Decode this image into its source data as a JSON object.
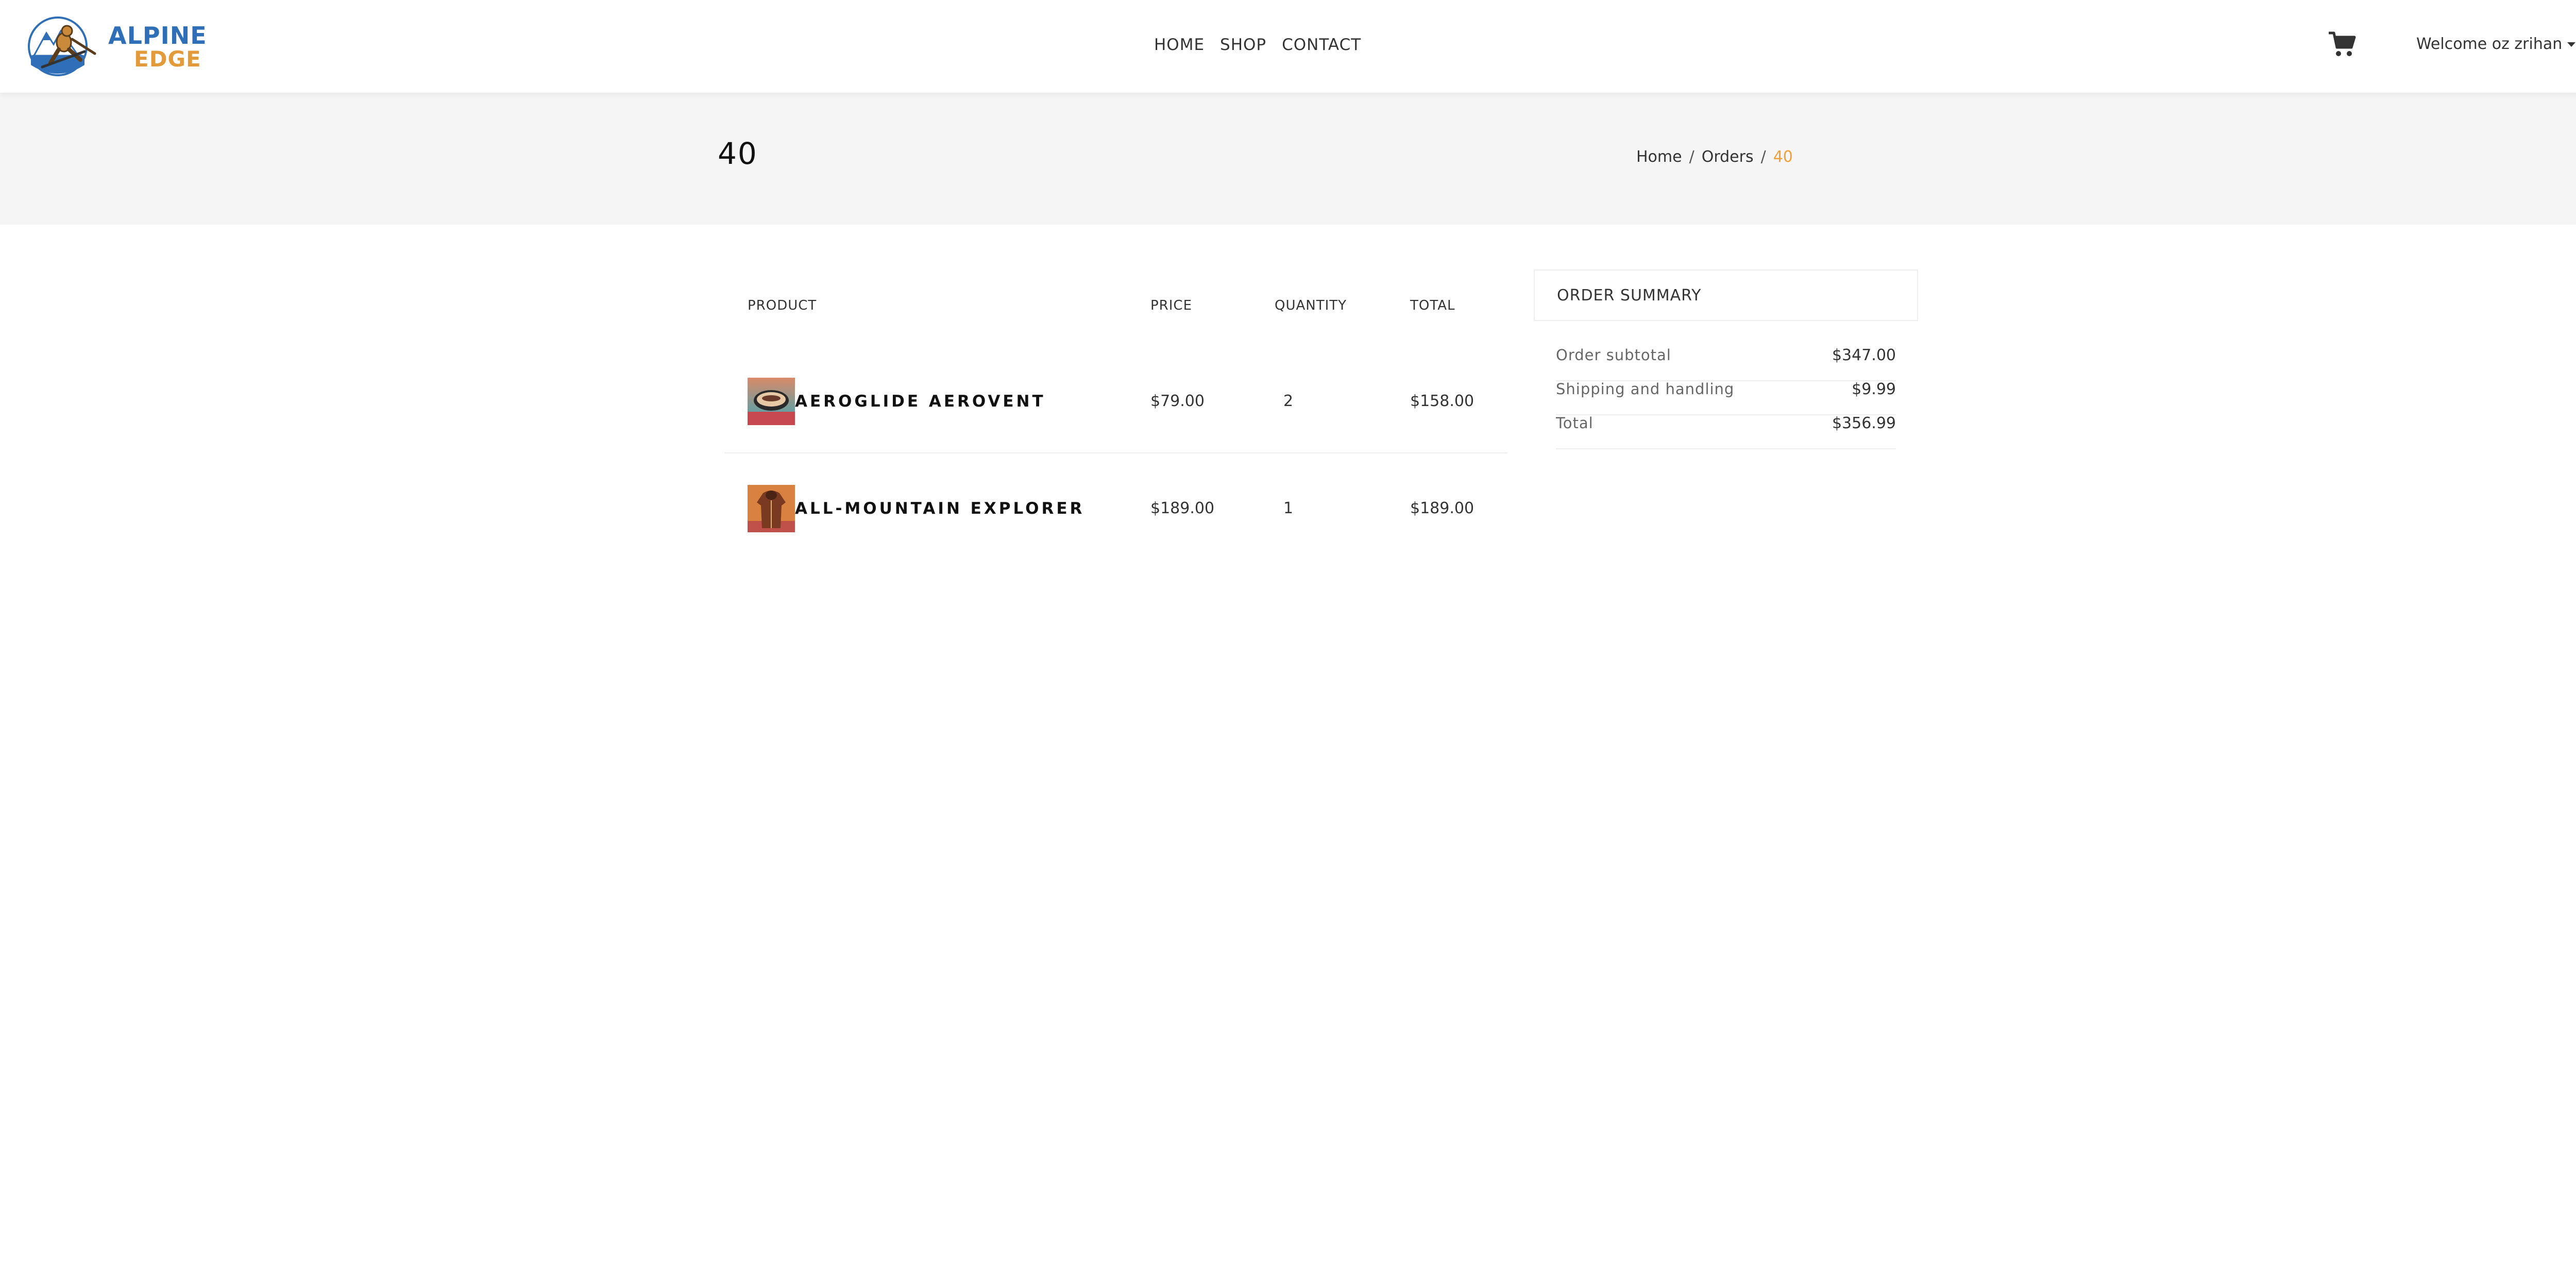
{
  "brand": {
    "name_line1": "ALPINE",
    "name_line2": "EDGE",
    "logo_icon": "skier-mountain-logo",
    "colors": {
      "blue": "#2f6fb7",
      "orange": "#e39a3a"
    }
  },
  "nav": {
    "links": [
      "HOME",
      "SHOP",
      "CONTACT"
    ],
    "cart_icon": "shopping-cart-icon",
    "user_greeting": "Welcome oz zrihan"
  },
  "page_header": {
    "title": "40",
    "breadcrumb": {
      "home": "Home",
      "orders": "Orders",
      "current": "40",
      "separator": "/"
    },
    "accent_color": "#f0a036"
  },
  "order_table": {
    "headers": {
      "product": "PRODUCT",
      "price": "PRICE",
      "quantity": "QUANTITY",
      "total": "TOTAL"
    },
    "items": [
      {
        "name": "AEROGLIDE AEROVENT",
        "price": "$79.00",
        "quantity": "2",
        "total": "$158.00",
        "image": "ski-goggles-image"
      },
      {
        "name": "ALL-MOUNTAIN EXPLORER",
        "price": "$189.00",
        "quantity": "1",
        "total": "$189.00",
        "image": "ski-jacket-image"
      }
    ]
  },
  "summary": {
    "title": "ORDER SUMMARY",
    "subtotal_label": "Order subtotal",
    "subtotal_value": "$347.00",
    "shipping_label": "Shipping and handling",
    "shipping_value": "$9.99",
    "total_label": "Total",
    "total_value": "$356.99"
  }
}
